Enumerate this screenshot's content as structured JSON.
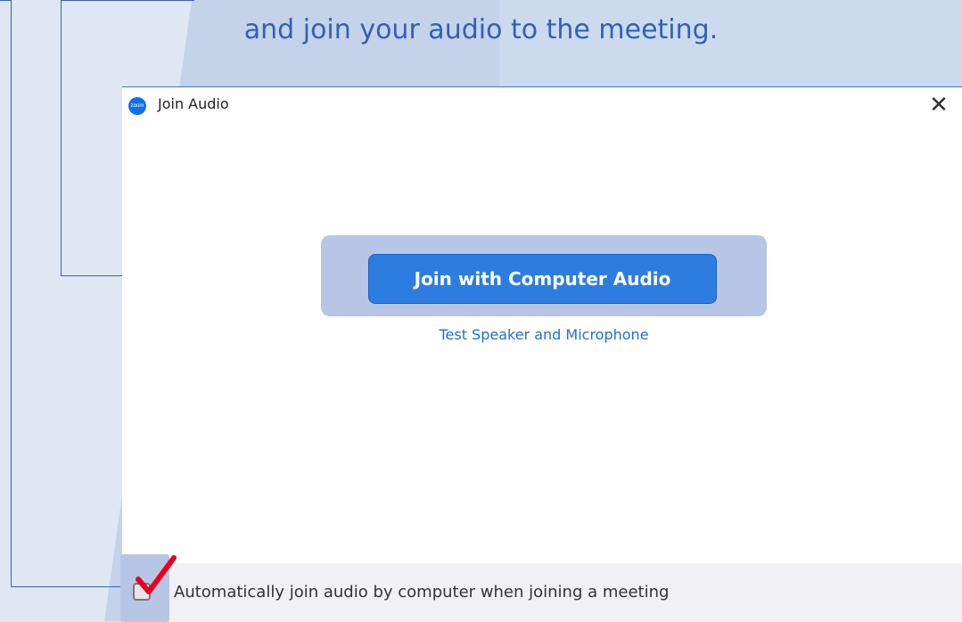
{
  "instruction": {
    "text": "and join your audio to the meeting."
  },
  "dialog": {
    "title": "Join Audio",
    "app_logo_text": "zoom",
    "close_glyph": "✕",
    "join_button_label": "Join with Computer Audio",
    "test_link_label": "Test Speaker and Microphone",
    "auto_join_label": "Automatically join audio by computer when joining a meeting",
    "auto_join_checked": true
  },
  "colors": {
    "accent": "#2d7ce0",
    "link": "#1e6fd9",
    "instruction_text": "#2f62b4",
    "checkmark": "#e8001e",
    "highlight": "#b6c6e4"
  },
  "icons": [
    "zoom-logo-icon",
    "close-icon",
    "checkmark-icon"
  ]
}
